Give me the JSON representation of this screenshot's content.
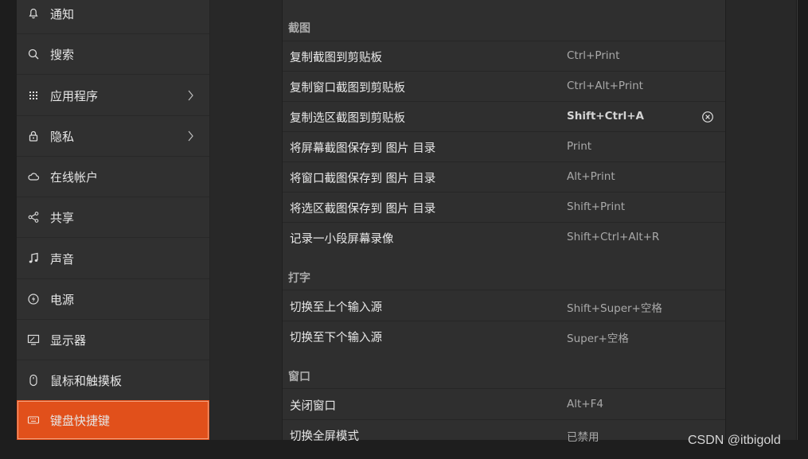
{
  "sidebar": {
    "items": [
      {
        "label": "通知",
        "icon": "bell-icon"
      },
      {
        "label": "搜索",
        "icon": "search-icon"
      },
      {
        "label": "应用程序",
        "icon": "apps-grid-icon",
        "chevron": true
      },
      {
        "label": "隐私",
        "icon": "lock-icon",
        "chevron": true
      },
      {
        "label": "在线帐户",
        "icon": "cloud-icon"
      },
      {
        "label": "共享",
        "icon": "share-icon"
      },
      {
        "label": "声音",
        "icon": "music-note-icon"
      },
      {
        "label": "电源",
        "icon": "power-icon"
      },
      {
        "label": "显示器",
        "icon": "display-icon"
      },
      {
        "label": "鼠标和触摸板",
        "icon": "mouse-icon"
      },
      {
        "label": "键盘快捷键",
        "icon": "keyboard-icon",
        "active": true
      }
    ]
  },
  "shortcuts": {
    "sections": [
      {
        "title": "截图",
        "rows": [
          {
            "name": "复制截图到剪贴板",
            "accel": "Ctrl+Print"
          },
          {
            "name": "复制窗口截图到剪贴板",
            "accel": "Ctrl+Alt+Print"
          },
          {
            "name": "复制选区截图到剪贴板",
            "accel": "Shift+Ctrl+A",
            "custom": true
          },
          {
            "name": "将屏幕截图保存到 图片 目录",
            "accel": "Print"
          },
          {
            "name": "将窗口截图保存到 图片 目录",
            "accel": "Alt+Print"
          },
          {
            "name": "将选区截图保存到 图片 目录",
            "accel": "Shift+Print"
          },
          {
            "name": "记录一小段屏幕录像",
            "accel": "Shift+Ctrl+Alt+R"
          }
        ]
      },
      {
        "title": "打字",
        "rows": [
          {
            "name": "切换至上个输入源",
            "accel": "Shift+Super+空格"
          },
          {
            "name": "切换至下个输入源",
            "accel": "Super+空格"
          }
        ]
      },
      {
        "title": "窗口",
        "rows": [
          {
            "name": "关闭窗口",
            "accel": "Alt+F4"
          },
          {
            "name": "切换全屏模式",
            "accel": "已禁用"
          }
        ]
      }
    ]
  },
  "watermark": "CSDN @itbigold",
  "colors": {
    "accent": "#e1501b",
    "sidebar_bg": "#303030",
    "panel_bg": "#2f2f2f"
  }
}
